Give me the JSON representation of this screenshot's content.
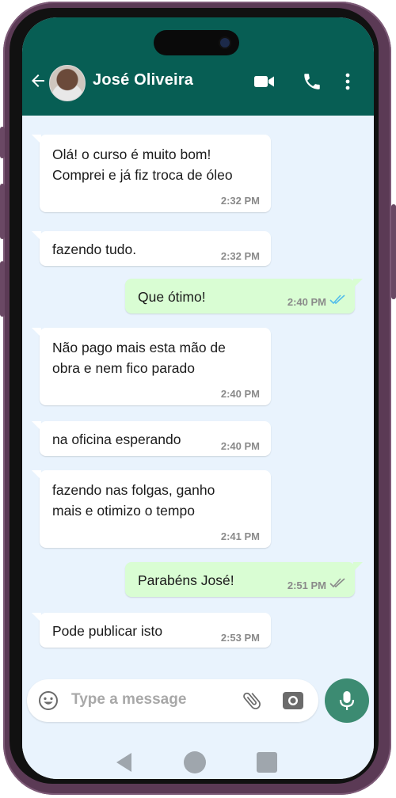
{
  "header": {
    "contact_name": "José Oliveira",
    "icons": [
      "back-arrow-icon",
      "video-call-icon",
      "phone-call-icon",
      "more-vertical-icon"
    ],
    "color": "#075e54"
  },
  "messages": [
    {
      "direction": "in",
      "text": "Olá! o curso é muito bom!\nComprei e já fiz troca de óleo",
      "time": "2:32 PM"
    },
    {
      "direction": "in",
      "text": "fazendo tudo.",
      "time": "2:32 PM"
    },
    {
      "direction": "out",
      "text": "Que ótimo!",
      "time": "2:40 PM",
      "ticks": "read"
    },
    {
      "direction": "in",
      "text": "Não pago mais esta mão de\nobra e nem fico parado",
      "time": "2:40 PM"
    },
    {
      "direction": "in",
      "text": "na oficina esperando",
      "time": "2:40 PM"
    },
    {
      "direction": "in",
      "text": "fazendo nas folgas, ganho\nmais e otimizo o tempo",
      "time": "2:41 PM"
    },
    {
      "direction": "out",
      "text": "Parabéns José!",
      "time": "2:51 PM",
      "ticks": "delivered"
    },
    {
      "direction": "in",
      "text": "Pode publicar isto",
      "time": "2:53 PM"
    }
  ],
  "composer": {
    "placeholder": "Type a message",
    "icons": [
      "emoji-icon",
      "attach-icon",
      "camera-icon",
      "mic-icon"
    ]
  },
  "colors": {
    "chat_background": "#e9f3fd",
    "outgoing_bubble": "#d9fdd3",
    "incoming_bubble": "#ffffff",
    "read_ticks": "#53bdeb",
    "mic_button": "#3c8b72"
  }
}
